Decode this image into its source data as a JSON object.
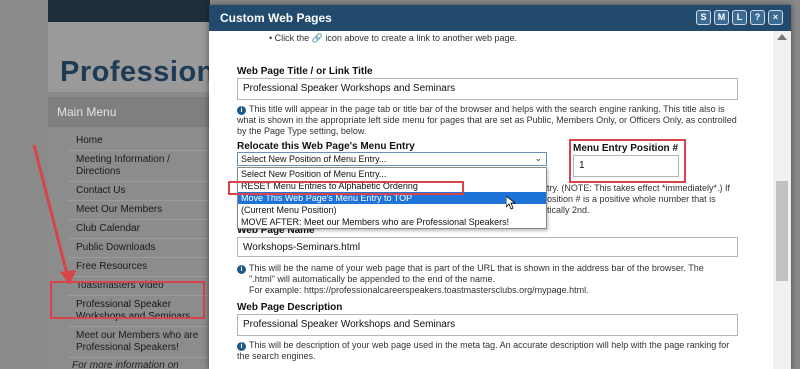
{
  "background": {
    "site_title": "Profession",
    "main_menu_label": "Main Menu",
    "menu_items": [
      "Home",
      "Meeting Information / Directions",
      "Contact Us",
      "Meet Our Members",
      "Club Calendar",
      "Public Downloads",
      "Free Resources",
      "Toastmasters Video",
      "Professional Speaker Workshops and Seminars",
      "Meet our Members who are Professional Speakers!"
    ],
    "more_info": "For more information on"
  },
  "modal": {
    "title": "Custom Web Pages",
    "buttons": [
      "S",
      "M",
      "L",
      "?",
      "×"
    ],
    "top_note": "Click the 🔗 icon above to create a link to another web page.",
    "link_title": {
      "label": "Web Page Title / or Link Title",
      "value": "Professional Speaker Workshops and Seminars",
      "help": "This title will appear in the page tab or title bar of the browser and helps with the search engine ranking. This title also is what is shown in the appropriate left side menu for pages that are set as Public, Members Only, or Officers Only, as controlled by the Page Type setting, below."
    },
    "relocate": {
      "label": "Relocate this Web Page's Menu Entry",
      "selected": "Select New Position of Menu Entry...",
      "options": [
        "Select New Position of Menu Entry...",
        "RESET Menu Entries to Alphabetic Ordering",
        "Move This Web Page's Menu Entry to TOP",
        "(Current Menu Position)",
        "MOVE AFTER: Meet our Members who are Professional Speakers!"
      ],
      "highlighted_index": 2,
      "help_right_line1": "try. (NOTE: This takes effect *immediately*.) If",
      "help_right_line2": "osition # is a positive whole number that is",
      "help_right_line3": "tically 2nd."
    },
    "position": {
      "label": "Menu Entry Position #",
      "value": "1"
    },
    "page_name": {
      "label": "Web Page Name",
      "value": "Workshops-Seminars.html",
      "help1": "This will be the name of your web page that is part of the URL that is shown in the address bar of the browser. The",
      "help2": "\".html\" will automatically be appended to the end of the name.",
      "help3": "For example: https://professionalcareerspeakers.toastmastersclubs.org/mypage.html."
    },
    "description": {
      "label": "Web Page Description",
      "value": "Professional Speaker Workshops and Seminars",
      "help": "This will be description of your web page used in the meta tag. An accurate description will help with the page ranking for the search engines."
    }
  },
  "colors": {
    "header": "#214a6c",
    "highlight": "#1e73d8",
    "annotation": "#d9434a"
  }
}
